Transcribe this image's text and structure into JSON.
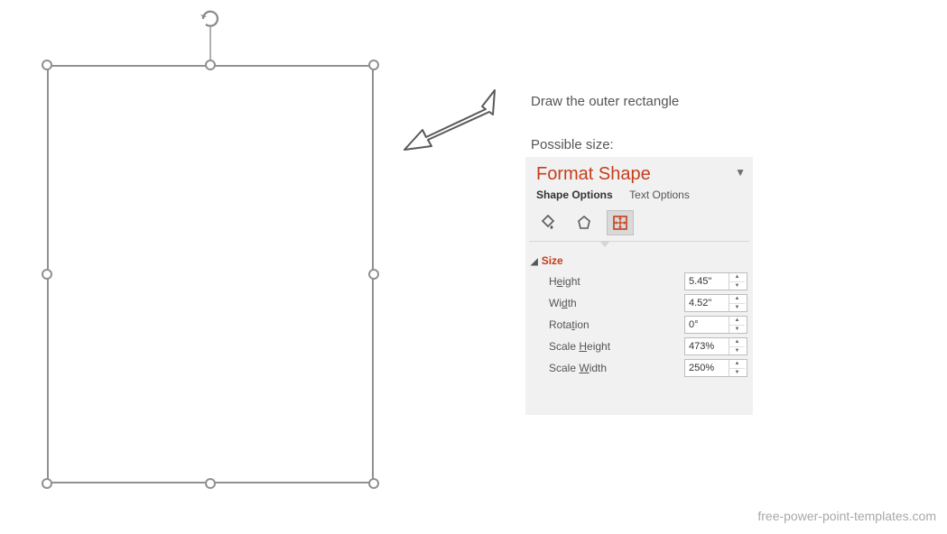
{
  "instructions": {
    "line1": "Draw the outer rectangle",
    "line2": "Possible size:"
  },
  "panel": {
    "title": "Format Shape",
    "tab_shape": "Shape Options",
    "tab_text": "Text Options",
    "section_size": "Size",
    "rows": {
      "height_label_pre": "H",
      "height_label_u": "e",
      "height_label_post": "ight",
      "height_value": "5.45\"",
      "width_label_pre": "Wi",
      "width_label_u": "d",
      "width_label_post": "th",
      "width_value": "4.52\"",
      "rotation_label_pre": "Rota",
      "rotation_label_u": "t",
      "rotation_label_post": "ion",
      "rotation_value": "0°",
      "scaleh_label_pre": "Scale ",
      "scaleh_label_u": "H",
      "scaleh_label_post": "eight",
      "scaleh_value": "473%",
      "scalew_label_pre": "Scale ",
      "scalew_label_u": "W",
      "scalew_label_post": "idth",
      "scalew_value": "250%"
    }
  },
  "watermark": "free-power-point-templates.com"
}
